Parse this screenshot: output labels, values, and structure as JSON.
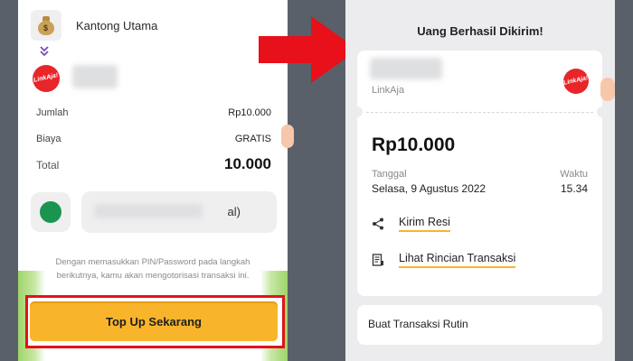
{
  "left": {
    "wallet_name": "Kantong Utama",
    "logo_text": "LinkAja!",
    "rows": [
      {
        "label": "Jumlah",
        "value": "Rp10.000"
      },
      {
        "label": "Biaya",
        "value": "GRATIS"
      },
      {
        "label": "Total",
        "value": "10.000"
      }
    ],
    "account_suffix": "al)",
    "pin_note": "Dengan memasukkan PIN/Password pada langkah berikutnya, kamu akan mengotorisasi transaksi ini.",
    "topup_label": "Top Up Sekarang"
  },
  "right": {
    "title": "Uang Berhasil Dikirim!",
    "provider": "LinkAja",
    "logo_text": "LinkAja!",
    "amount": "Rp10.000",
    "date_label": "Tanggal",
    "date_value": "Selasa, 9 Agustus 2022",
    "time_label": "Waktu",
    "time_value": "15.34",
    "actions": [
      {
        "label": "Kirim Resi",
        "icon": "share-icon"
      },
      {
        "label": "Lihat Rincian Transaksi",
        "icon": "receipt-icon"
      }
    ],
    "routine_label": "Buat Transaksi Rutin"
  },
  "colors": {
    "accent": "#f8b52b",
    "highlight": "#e4121b",
    "arrow": "#e8101a",
    "brand_red": "#e82529",
    "account_green": "#1a9550"
  }
}
